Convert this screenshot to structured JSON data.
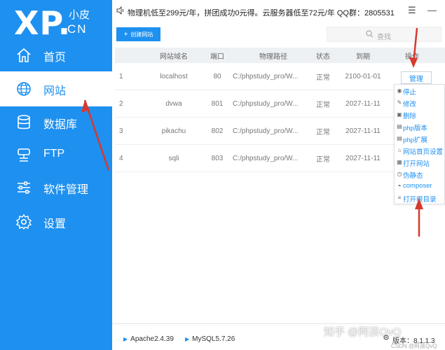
{
  "app": {
    "logo_big": "XP.",
    "logo_cn_top": "小皮",
    "logo_cn_bottom": "CN"
  },
  "sidebar": {
    "items": [
      {
        "label": "首页",
        "icon": "home-icon"
      },
      {
        "label": "网站",
        "icon": "globe-icon"
      },
      {
        "label": "数据库",
        "icon": "database-icon"
      },
      {
        "label": "FTP",
        "icon": "server-icon"
      },
      {
        "label": "软件管理",
        "icon": "sliders-icon"
      },
      {
        "label": "设置",
        "icon": "gear-icon"
      }
    ],
    "active_index": 1
  },
  "topbar": {
    "notice": "物理机低至299元/年，拼团成功0元得。云服务器低至72元/年 QQ群：2805531",
    "menu_symbol": "☰",
    "minimize_symbol": "—"
  },
  "toolbar": {
    "create_label": "创建网站",
    "search_placeholder": "查找"
  },
  "table": {
    "headers": {
      "domain": "网站域名",
      "port": "端口",
      "path": "物理路径",
      "status": "状态",
      "expire": "到期",
      "op": "操作"
    },
    "rows": [
      {
        "id": "1",
        "domain": "localhost",
        "port": "80",
        "path": "C:/phpstudy_pro/W...",
        "status": "正常",
        "expire": "2100-01-01",
        "op": "管理"
      },
      {
        "id": "2",
        "domain": "dvwa",
        "port": "801",
        "path": "C:/phpstudy_pro/W...",
        "status": "正常",
        "expire": "2027-11-11",
        "op": ""
      },
      {
        "id": "3",
        "domain": "pikachu",
        "port": "802",
        "path": "C:/phpstudy_pro/W...",
        "status": "正常",
        "expire": "2027-11-11",
        "op": ""
      },
      {
        "id": "4",
        "domain": "sqli",
        "port": "803",
        "path": "C:/phpstudy_pro/W...",
        "status": "正常",
        "expire": "2027-11-11",
        "op": ""
      }
    ]
  },
  "dropdown": {
    "items": [
      {
        "label": "停止",
        "icon": "stop-icon",
        "glyph": "◉"
      },
      {
        "label": "修改",
        "icon": "edit-icon",
        "glyph": "✎"
      },
      {
        "label": "删除",
        "icon": "trash-icon",
        "glyph": "▣"
      },
      {
        "label": "php版本",
        "icon": "php-icon",
        "glyph": "▤"
      },
      {
        "label": "php扩展",
        "icon": "extension-icon",
        "glyph": "▤"
      },
      {
        "label": "网站首页设置",
        "icon": "homepage-icon",
        "glyph": "⌂"
      },
      {
        "label": "打开网站",
        "icon": "open-site-icon",
        "glyph": "▦"
      },
      {
        "label": "伪静态",
        "icon": "rewrite-icon",
        "glyph": "◷"
      },
      {
        "label": "composer",
        "icon": "composer-icon",
        "glyph": "◓"
      },
      {
        "label": "打开根目录",
        "icon": "folder-icon",
        "glyph": "≡"
      }
    ]
  },
  "bottombar": {
    "services": [
      {
        "label": "Apache2.4.39"
      },
      {
        "label": "MySQL5.7.26"
      }
    ],
    "version": "版本：8.1.1.3",
    "watermark_main": "知乎 @阿孩QvQ",
    "watermark_sub": "CSDN @阿孩QvQ"
  },
  "colors": {
    "accent": "#1e90f0",
    "arrow": "#d6392e"
  }
}
